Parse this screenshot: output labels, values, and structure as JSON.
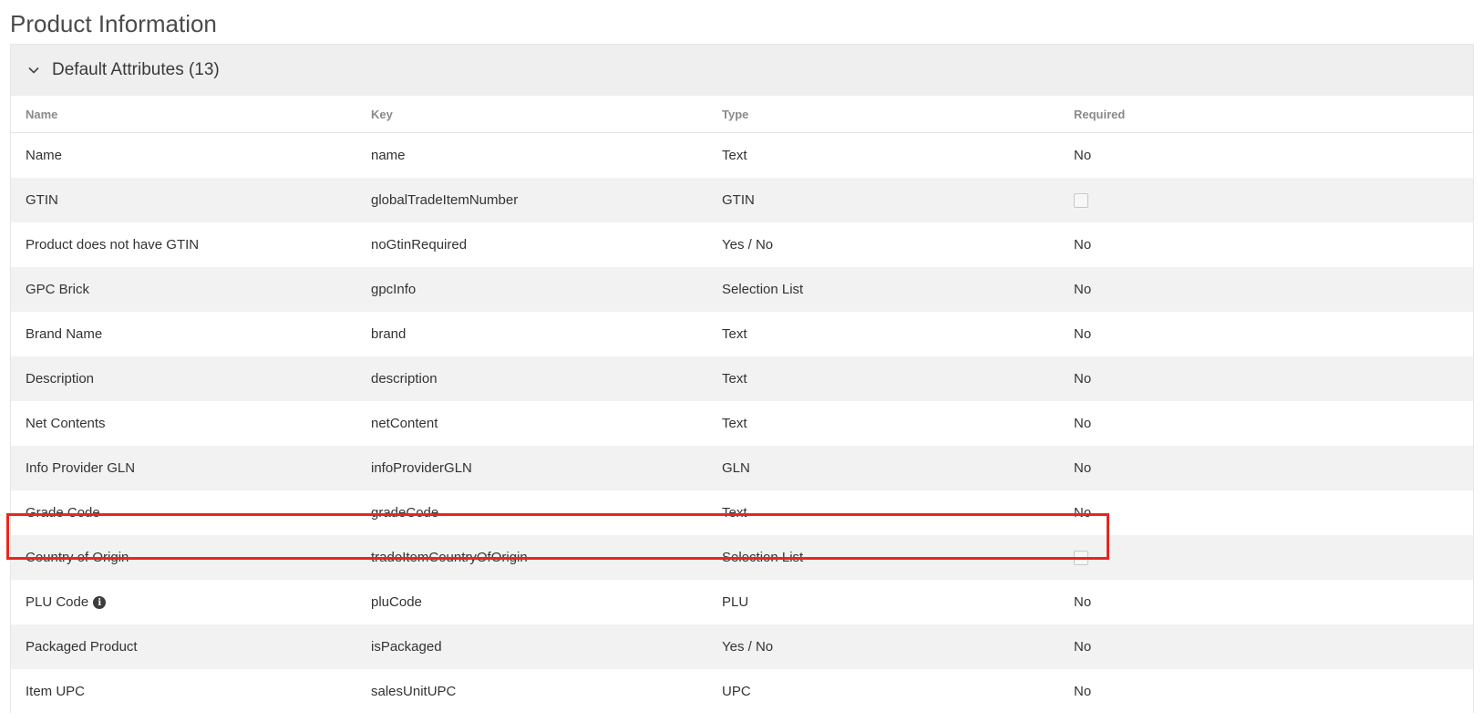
{
  "page": {
    "title": "Product Information"
  },
  "section": {
    "title": "Default Attributes (13)"
  },
  "table": {
    "headers": {
      "name": "Name",
      "key": "Key",
      "type": "Type",
      "required": "Required"
    },
    "rows": [
      {
        "name": "Name",
        "key": "name",
        "type": "Text",
        "required": "No"
      },
      {
        "name": "GTIN",
        "key": "globalTradeItemNumber",
        "type": "GTIN",
        "required": ""
      },
      {
        "name": "Product does not have GTIN",
        "key": "noGtinRequired",
        "type": "Yes / No",
        "required": "No"
      },
      {
        "name": "GPC Brick",
        "key": "gpcInfo",
        "type": "Selection List",
        "required": "No"
      },
      {
        "name": "Brand Name",
        "key": "brand",
        "type": "Text",
        "required": "No"
      },
      {
        "name": "Description",
        "key": "description",
        "type": "Text",
        "required": "No"
      },
      {
        "name": "Net Contents",
        "key": "netContent",
        "type": "Text",
        "required": "No"
      },
      {
        "name": "Info Provider GLN",
        "key": "infoProviderGLN",
        "type": "GLN",
        "required": "No"
      },
      {
        "name": "Grade Code",
        "key": "gradeCode",
        "type": "Text",
        "required": "No"
      },
      {
        "name": "Country of Origin",
        "key": "tradeItemCountryOfOrigin",
        "type": "Selection List",
        "required": ""
      },
      {
        "name": "PLU Code",
        "key": "pluCode",
        "type": "PLU",
        "required": "No"
      },
      {
        "name": "Packaged Product",
        "key": "isPackaged",
        "type": "Yes / No",
        "required": "No"
      },
      {
        "name": "Item UPC",
        "key": "salesUnitUPC",
        "type": "UPC",
        "required": "No"
      }
    ]
  },
  "icons": {
    "collapse": "chevron-down-icon",
    "info": "info-icon"
  },
  "colors": {
    "highlight": "#e8261e",
    "row_alt": "#f2f2f2",
    "header_bg": "#efefef"
  }
}
